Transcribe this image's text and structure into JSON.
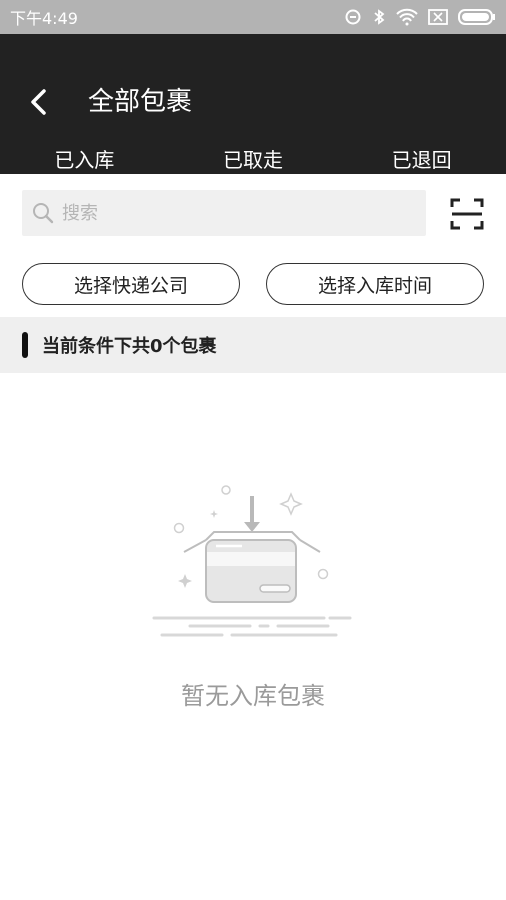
{
  "status_bar": {
    "time": "下午4:49"
  },
  "header": {
    "title": "全部包裹"
  },
  "tabs": [
    {
      "label": "已入库"
    },
    {
      "label": "已取走"
    },
    {
      "label": "已退回"
    }
  ],
  "search": {
    "placeholder": "搜索",
    "value": ""
  },
  "filters": {
    "courier_label": "选择快递公司",
    "time_label": "选择入库时间"
  },
  "summary": {
    "text": "当前条件下共0个包裹"
  },
  "empty": {
    "text": "暂无入库包裹"
  }
}
